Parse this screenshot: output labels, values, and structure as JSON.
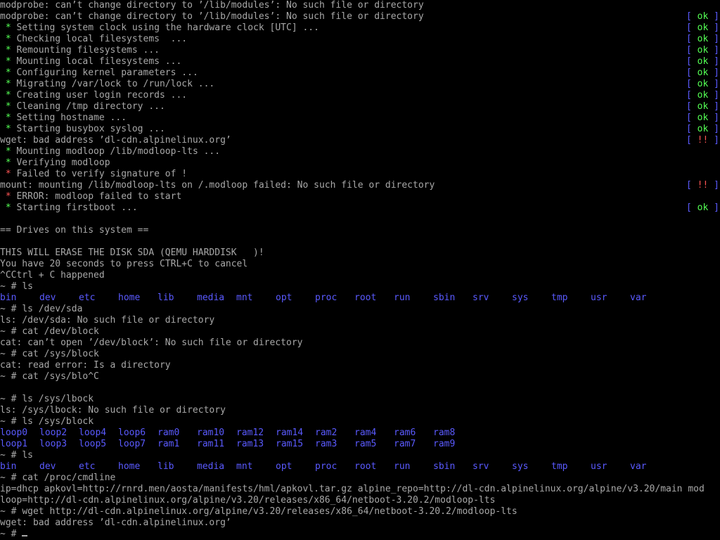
{
  "colors": {
    "background": "#000000",
    "text": "#a8a8a8",
    "ok_bracket": "#5a5aff",
    "ok_text": "#54ff54",
    "error": "#ff5454",
    "directory": "#5a5aff"
  },
  "boot": {
    "modprobe_1": "modprobe: can’t change directory to ’/lib/modules’: No such file or directory",
    "modprobe_2": "modprobe: can’t change directory to ’/lib/modules’: No such file or directory",
    "services": [
      {
        "bullet": "*",
        "text": "Setting system clock using the hardware clock [UTC] ...",
        "status": "ok"
      },
      {
        "bullet": "*",
        "text": "Checking local filesystems  ...",
        "status": "ok"
      },
      {
        "bullet": "*",
        "text": "Remounting filesystems ...",
        "status": "ok"
      },
      {
        "bullet": "*",
        "text": "Mounting local filesystems ...",
        "status": "ok"
      },
      {
        "bullet": "*",
        "text": "Configuring kernel parameters ...",
        "status": "ok"
      },
      {
        "bullet": "*",
        "text": "Migrating /var/lock to /run/lock ...",
        "status": "ok"
      },
      {
        "bullet": "*",
        "text": "Creating user login records ...",
        "status": "ok"
      },
      {
        "bullet": "*",
        "text": "Cleaning /tmp directory ...",
        "status": "ok"
      },
      {
        "bullet": "*",
        "text": "Setting hostname ...",
        "status": "ok"
      },
      {
        "bullet": "*",
        "text": "Starting busybox syslog ...",
        "status": "ok"
      }
    ],
    "wget_error": "wget: bad address ’dl-cdn.alpinelinux.org’",
    "modloop_mount": "Mounting modloop /lib/modloop-lts ...",
    "modloop_verify": "Verifying modloop",
    "modloop_sig": "Failed to verify signature of !",
    "mount_error": "mount: mounting /lib/modloop-lts on /.modloop failed: No such file or directory",
    "modloop_failed": "ERROR: modloop failed to start",
    "firstboot": "Starting firstboot ...",
    "bullet": "*",
    "ok_open": "[ ",
    "ok_word": "ok",
    "ok_close": " ]",
    "fail_word": "!!"
  },
  "firstboot": {
    "drives_header": "== Drives on this system ==",
    "erase_warning": "THIS WILL ERASE THE DISK SDA (QEMU HARDDISK   )!",
    "countdown": "You have 20 seconds to press CTRL+C to cancel",
    "cancelled": "^CCtrl + C happened"
  },
  "session": {
    "prompt": "~ # ",
    "cmd_ls_1": "ls",
    "root_dirs": [
      "bin",
      "dev",
      "etc",
      "home",
      "lib",
      "media",
      "mnt",
      "opt",
      "proc",
      "root",
      "run",
      "sbin",
      "srv",
      "sys",
      "tmp",
      "usr",
      "var"
    ],
    "cmd_ls_sda": "ls /dev/sda",
    "out_ls_sda": "ls: /dev/sda: No such file or directory",
    "cmd_cat_block": "cat /dev/block",
    "out_cat_block": "cat: can’t open ’/dev/block’: No such file or directory",
    "cmd_cat_sys_block": "cat /sys/block",
    "out_cat_sys_block": "cat: read error: Is a directory",
    "cmd_cat_blo": "cat /sys/blo^C",
    "cmd_ls_lbock": "ls /sys/lbock",
    "out_ls_lbock": "ls: /sys/lbock: No such file or directory",
    "cmd_ls_sys_block": "ls /sys/block",
    "block_row_1": [
      "loop0",
      "loop2",
      "loop4",
      "loop6",
      "ram0",
      "ram10",
      "ram12",
      "ram14",
      "ram2",
      "ram4",
      "ram6",
      "ram8"
    ],
    "block_row_2": [
      "loop1",
      "loop3",
      "loop5",
      "loop7",
      "ram1",
      "ram11",
      "ram13",
      "ram15",
      "ram3",
      "ram5",
      "ram7",
      "ram9"
    ],
    "cmd_ls_2": "ls",
    "cmd_cmdline": "cat /proc/cmdline",
    "cmdline_1": "ip=dhcp apkovl=http://rnrd.men/aosta/manifests/hml/apkovl.tar.gz alpine_repo=http://dl-cdn.alpinelinux.org/alpine/v3.20/main mod",
    "cmdline_2": "loop=http://dl-cdn.alpinelinux.org/alpine/v3.20/releases/x86_64/netboot-3.20.2/modloop-lts",
    "cmd_wget": "wget http://dl-cdn.alpinelinux.org/alpine/v3.20/releases/x86_64/netboot-3.20.2/modloop-lts",
    "out_wget": "wget: bad address ’dl-cdn.alpinelinux.org’"
  }
}
